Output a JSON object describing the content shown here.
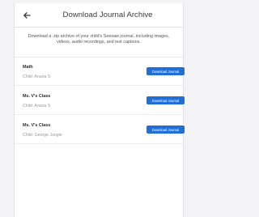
{
  "header": {
    "title": "Download Journal Archive",
    "back_icon": "back-arrow-icon"
  },
  "description": "Download a .zip archive of your child's Seesaw journal, including images, videos, audio recordings, and text captions.",
  "classes": [
    {
      "name": "Math",
      "child": "Child: Anaria S",
      "button_label": "Download Journal"
    },
    {
      "name": "Ms. V's Class",
      "child": "Child: Anaria S",
      "button_label": "Download Journal"
    },
    {
      "name": "Ms. V's Class",
      "child": "Child: George Jungle",
      "button_label": "Download Journal"
    }
  ],
  "colors": {
    "accent": "#1f6fd6",
    "background": "#f3f3f5"
  }
}
